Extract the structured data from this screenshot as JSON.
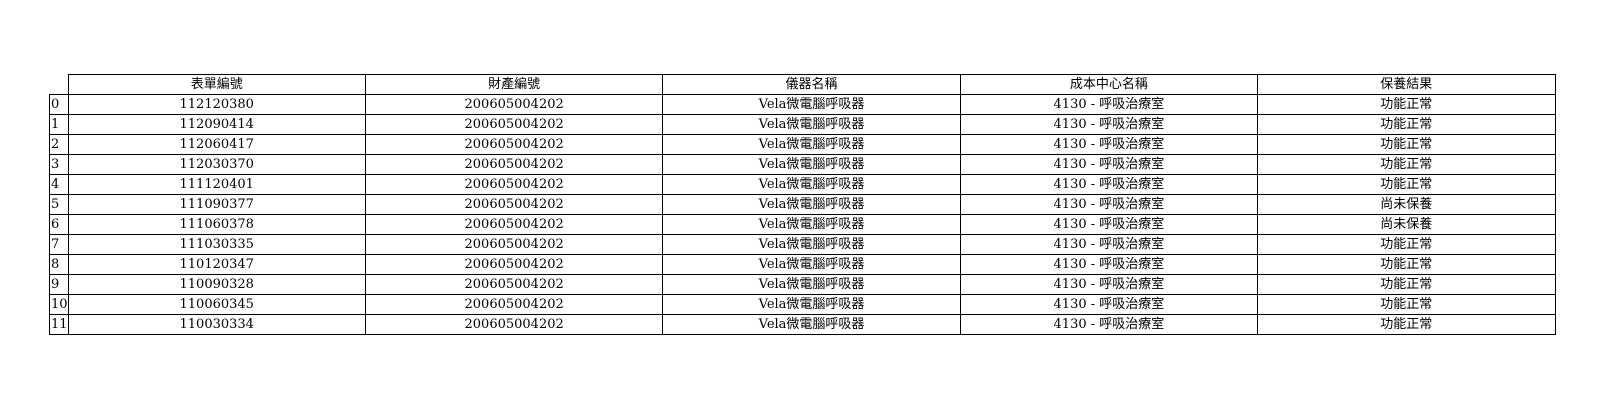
{
  "table": {
    "columns": [
      "表單編號",
      "財產編號",
      "儀器名稱",
      "成本中心名稱",
      "保養結果"
    ],
    "rows": [
      {
        "index": "0",
        "form_no": "112120380",
        "asset_no": "200605004202",
        "instrument": "Vela微電腦呼吸器",
        "cost_center": "4130 - 呼吸治療室",
        "result": "功能正常"
      },
      {
        "index": "1",
        "form_no": "112090414",
        "asset_no": "200605004202",
        "instrument": "Vela微電腦呼吸器",
        "cost_center": "4130 - 呼吸治療室",
        "result": "功能正常"
      },
      {
        "index": "2",
        "form_no": "112060417",
        "asset_no": "200605004202",
        "instrument": "Vela微電腦呼吸器",
        "cost_center": "4130 - 呼吸治療室",
        "result": "功能正常"
      },
      {
        "index": "3",
        "form_no": "112030370",
        "asset_no": "200605004202",
        "instrument": "Vela微電腦呼吸器",
        "cost_center": "4130 - 呼吸治療室",
        "result": "功能正常"
      },
      {
        "index": "4",
        "form_no": "111120401",
        "asset_no": "200605004202",
        "instrument": "Vela微電腦呼吸器",
        "cost_center": "4130 - 呼吸治療室",
        "result": "功能正常"
      },
      {
        "index": "5",
        "form_no": "111090377",
        "asset_no": "200605004202",
        "instrument": "Vela微電腦呼吸器",
        "cost_center": "4130 - 呼吸治療室",
        "result": "尚未保養"
      },
      {
        "index": "6",
        "form_no": "111060378",
        "asset_no": "200605004202",
        "instrument": "Vela微電腦呼吸器",
        "cost_center": "4130 - 呼吸治療室",
        "result": "尚未保養"
      },
      {
        "index": "7",
        "form_no": "111030335",
        "asset_no": "200605004202",
        "instrument": "Vela微電腦呼吸器",
        "cost_center": "4130 - 呼吸治療室",
        "result": "功能正常"
      },
      {
        "index": "8",
        "form_no": "110120347",
        "asset_no": "200605004202",
        "instrument": "Vela微電腦呼吸器",
        "cost_center": "4130 - 呼吸治療室",
        "result": "功能正常"
      },
      {
        "index": "9",
        "form_no": "110090328",
        "asset_no": "200605004202",
        "instrument": "Vela微電腦呼吸器",
        "cost_center": "4130 - 呼吸治療室",
        "result": "功能正常"
      },
      {
        "index": "10",
        "form_no": "110060345",
        "asset_no": "200605004202",
        "instrument": "Vela微電腦呼吸器",
        "cost_center": "4130 - 呼吸治療室",
        "result": "功能正常"
      },
      {
        "index": "11",
        "form_no": "110030334",
        "asset_no": "200605004202",
        "instrument": "Vela微電腦呼吸器",
        "cost_center": "4130 - 呼吸治療室",
        "result": "功能正常"
      }
    ]
  }
}
